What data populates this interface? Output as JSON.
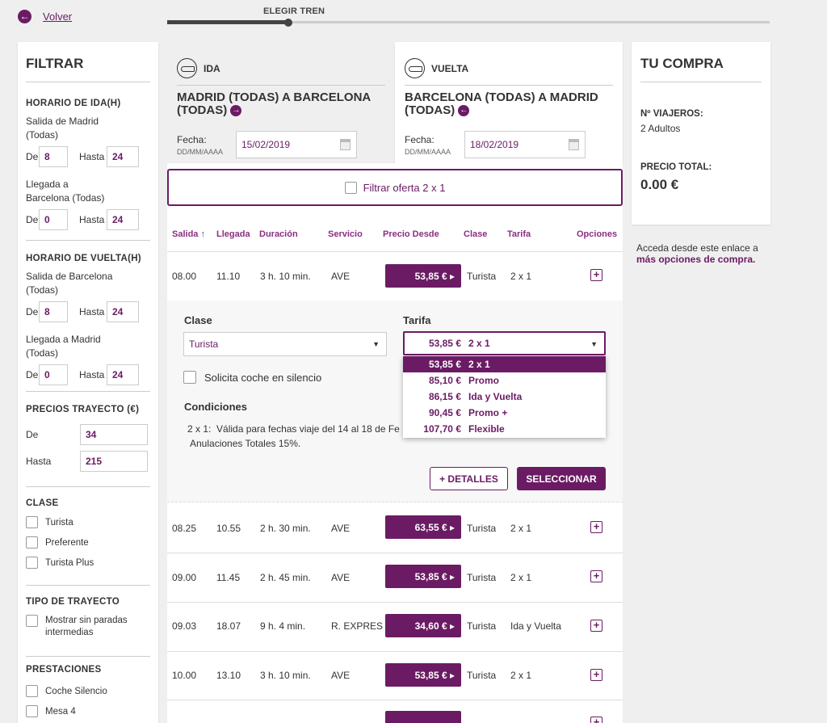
{
  "topbar": {
    "back_label": "Volver",
    "back_icon": "arrow-left-circle-icon",
    "progress_step": "ELEGIR TREN"
  },
  "filter": {
    "title": "FILTRAR",
    "ida": {
      "title": "HORARIO DE IDA(H)",
      "salida_label": "Salida de Madrid (Todas)",
      "salida_de": "8",
      "salida_hasta": "24",
      "llegada_label": "Llegada a Barcelona (Todas)",
      "llegada_de": "0",
      "llegada_hasta": "24"
    },
    "vuelta": {
      "title": "HORARIO DE VUELTA(H)",
      "salida_label": "Salida de Barcelona (Todas)",
      "salida_de": "8",
      "salida_hasta": "24",
      "llegada_label": "Llegada a Madrid (Todas)",
      "llegada_de": "0",
      "llegada_hasta": "24"
    },
    "de_label": "De",
    "hasta_label": "Hasta",
    "precios": {
      "title": "PRECIOS TRAYECTO (€)",
      "de_value": "34",
      "hasta_value": "215"
    },
    "clase": {
      "title": "CLASE",
      "options": [
        "Turista",
        "Preferente",
        "Turista Plus"
      ]
    },
    "tipo": {
      "title": "TIPO DE TRAYECTO",
      "option": "Mostrar sin paradas intermedias"
    },
    "prestaciones": {
      "title": "PRESTACIONES",
      "options": [
        "Coche Silencio",
        "Mesa 4"
      ]
    }
  },
  "ida": {
    "label": "IDA",
    "route": "MADRID (TODAS) A BARCELONA (TODAS)",
    "fecha_label": "Fecha:",
    "fecha_format": "DD/MM/AAAA",
    "fecha_value": "15/02/2019"
  },
  "vuelta": {
    "label": "VUELTA",
    "route": "BARCELONA (TODAS) A MADRID (TODAS)",
    "fecha_label": "Fecha:",
    "fecha_format": "DD/MM/AAAA",
    "fecha_value": "18/02/2019"
  },
  "offer_filter": "Filtrar oferta 2 x 1",
  "table": {
    "headers": {
      "salida": "Salida ↑",
      "llegada": "Llegada",
      "duracion": "Duración",
      "servicio": "Servicio",
      "precio": "Precio Desde",
      "clase": "Clase",
      "tarifa": "Tarifa",
      "opciones": "Opciones"
    },
    "rows": [
      {
        "salida": "08.00",
        "llegada": "11.10",
        "duracion": "3 h. 10 min.",
        "servicio": "AVE",
        "precio": "53,85 € ▸",
        "clase": "Turista",
        "tarifa": "2 x 1"
      },
      {
        "salida": "08.25",
        "llegada": "10.55",
        "duracion": "2 h. 30 min.",
        "servicio": "AVE",
        "precio": "63,55 € ▸",
        "clase": "Turista",
        "tarifa": "2 x 1"
      },
      {
        "salida": "09.00",
        "llegada": "11.45",
        "duracion": "2 h. 45 min.",
        "servicio": "AVE",
        "precio": "53,85 € ▸",
        "clase": "Turista",
        "tarifa": "2 x 1"
      },
      {
        "salida": "09.03",
        "llegada": "18.07",
        "duracion": "9 h. 4 min.",
        "servicio": "R. EXPRES",
        "precio": "34,60 € ▸",
        "clase": "Turista",
        "tarifa": "Ida y Vuelta"
      },
      {
        "salida": "10.00",
        "llegada": "13.10",
        "duracion": "3 h. 10 min.",
        "servicio": "AVE",
        "precio": "53,85 € ▸",
        "clase": "Turista",
        "tarifa": "2 x 1"
      }
    ]
  },
  "expanded": {
    "clase_title": "Clase",
    "clase_value": "Turista",
    "tarifa_title": "Tarifa",
    "tarifa_value_price": "53,85 €",
    "tarifa_value_name": "2 x 1",
    "silencio_label": "Solicita coche en silencio",
    "condiciones_title": "Condiciones",
    "condiciones_text_1": "2 x 1:  Válida para fechas viaje del 14 al 18 de Fe",
    "condiciones_text_2": "Anulaciones Totales 15%.",
    "dropdown": [
      {
        "price": "53,85 €",
        "name": "2 x 1"
      },
      {
        "price": "85,10 €",
        "name": "Promo"
      },
      {
        "price": "86,15 €",
        "name": "Ida y Vuelta"
      },
      {
        "price": "90,45 €",
        "name": "Promo +"
      },
      {
        "price": "107,70 €",
        "name": "Flexible"
      }
    ],
    "detalles_label": "+ DETALLES",
    "seleccionar_label": "SELECCIONAR"
  },
  "compra": {
    "title": "TU COMPRA",
    "viajeros_label": "Nº VIAJEROS:",
    "viajeros_value": "2 Adultos",
    "precio_label": "PRECIO TOTAL:",
    "precio_value": "0.00 €"
  },
  "acceda": {
    "text": "Acceda desde este enlace a",
    "link": "más opciones de compra."
  },
  "colors": {
    "accent": "#6b1b64",
    "background": "#efefef"
  }
}
